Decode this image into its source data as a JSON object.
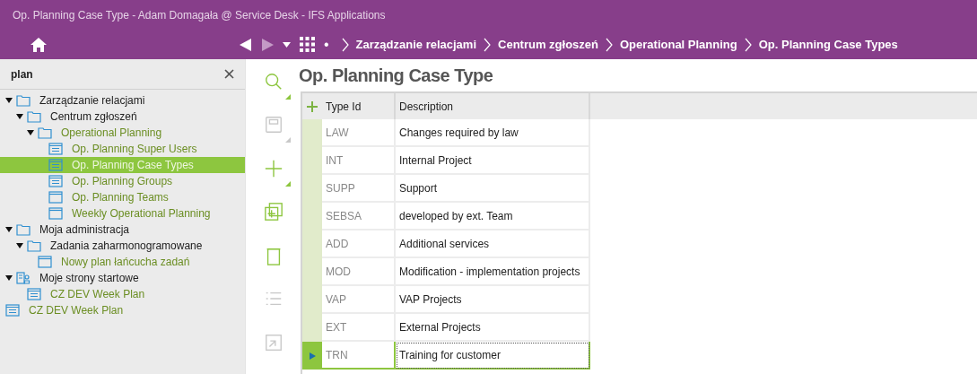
{
  "window": {
    "title": "Op. Planning Case Type - Adam Domagała @ Service Desk - IFS Applications"
  },
  "nav": {
    "menu_glyph": "•",
    "breadcrumbs": [
      "Zarządzanie relacjami",
      "Centrum zgłoszeń",
      "Operational Planning",
      "Op. Planning Case Types"
    ]
  },
  "navigator": {
    "search": {
      "value": "plan"
    },
    "tree": [
      {
        "kind": "folder",
        "label": "Zarządzanie relacjami",
        "expanded": true,
        "children": [
          {
            "kind": "folder",
            "label": "Centrum zgłoszeń",
            "expanded": true,
            "children": [
              {
                "kind": "folder",
                "label": "Operational Planning",
                "expanded": true,
                "match": true,
                "children": [
                  {
                    "kind": "list",
                    "label": "Op. Planning Super Users",
                    "selected": false
                  },
                  {
                    "kind": "list",
                    "label": "Op. Planning Case Types",
                    "selected": true
                  },
                  {
                    "kind": "list",
                    "label": "Op. Planning Groups",
                    "selected": false
                  },
                  {
                    "kind": "window",
                    "label": "Op. Planning Teams",
                    "selected": false
                  },
                  {
                    "kind": "window",
                    "label": "Weekly Operational Planning",
                    "selected": false
                  }
                ]
              }
            ]
          }
        ]
      },
      {
        "kind": "folder",
        "label": "Moja administracja",
        "expanded": true,
        "children": [
          {
            "kind": "folder",
            "label": "Zadania zaharmonogramowane",
            "expanded": true,
            "children": [
              {
                "kind": "window",
                "label": "Nowy plan łańcucha zadań",
                "selected": false
              }
            ]
          }
        ]
      },
      {
        "kind": "startpages",
        "label": "Moje strony startowe",
        "expanded": true,
        "children": [
          {
            "kind": "list",
            "label": "CZ DEV Week Plan",
            "selected": false
          }
        ]
      },
      {
        "kind": "list",
        "label": "CZ DEV Week Plan",
        "selected": false
      }
    ]
  },
  "toolbar": [
    {
      "kind": "search",
      "disabled": false
    },
    {
      "kind": "save",
      "disabled": true
    },
    {
      "kind": "new",
      "disabled": false
    },
    {
      "kind": "duplicate",
      "disabled": false
    },
    {
      "kind": "delete",
      "disabled": false
    },
    {
      "kind": "list",
      "disabled": true
    },
    {
      "kind": "expand",
      "disabled": true
    }
  ],
  "page": {
    "title": "Op. Planning Case Type"
  },
  "table": {
    "columns": [
      "Type Id",
      "Description"
    ],
    "rows": [
      {
        "type_id": "LAW",
        "description": "Changes required by law",
        "selected": false
      },
      {
        "type_id": "INT",
        "description": "Internal Project",
        "selected": false
      },
      {
        "type_id": "SUPP",
        "description": "Support",
        "selected": false
      },
      {
        "type_id": "SEBSA",
        "description": "developed by ext. Team",
        "selected": false
      },
      {
        "type_id": "ADD",
        "description": "Additional services",
        "selected": false
      },
      {
        "type_id": "MOD",
        "description": "Modification - implementation projects",
        "selected": false
      },
      {
        "type_id": "VAP",
        "description": "VAP Projects",
        "selected": false
      },
      {
        "type_id": "EXT",
        "description": "External Projects",
        "selected": false
      },
      {
        "type_id": "TRN",
        "description": "Training for customer",
        "selected": true
      }
    ]
  }
}
